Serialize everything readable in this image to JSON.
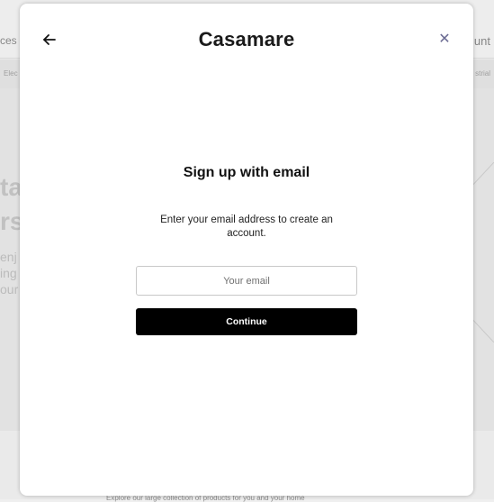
{
  "background": {
    "menu_left": "ces ˅",
    "menu_right": "unt",
    "category_left": "Elec",
    "category_right": "strial",
    "hero_line1": "ta",
    "hero_line2": "rs",
    "hero_paragraph": [
      "enj",
      "ing",
      "our"
    ],
    "footer_text": "Explore our large collection of products for you and your home"
  },
  "modal": {
    "back_icon": "arrow-left-icon",
    "close_icon": "close-icon",
    "close_symbol": "✕",
    "brand": "Casamare",
    "title": "Sign up with email",
    "subtitle": "Enter your email address to create an account.",
    "email_placeholder": "Your email",
    "email_value": "",
    "continue_label": "Continue"
  }
}
